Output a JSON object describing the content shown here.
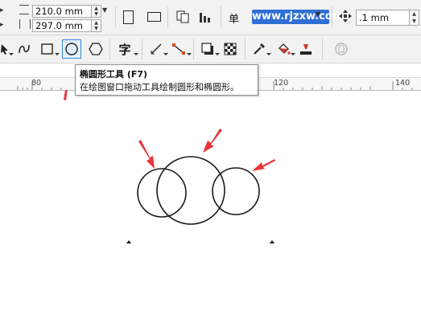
{
  "property_bar": {
    "width_value": "210.0 mm",
    "height_value": "297.0 mm",
    "units_label": "单",
    "nudge_value": ".1 mm"
  },
  "watermark": {
    "text": "www.rjzxw.com"
  },
  "ruler": {
    "labels": [
      "80",
      "120",
      "140"
    ]
  },
  "tooltip": {
    "title": "椭圆形工具 (F7)",
    "description": "在绘图窗口拖动工具绘制圆形和椭圆形。"
  },
  "toolbox": {
    "tools": [
      "pick-icon",
      "freehand-curve-icon",
      "rectangle-icon",
      "ellipse-icon",
      "polygon-icon",
      "text-icon",
      "dimension-icon",
      "connector-icon",
      "drop-shadow-icon",
      "transparency-icon",
      "eyedropper-icon",
      "fill-icon",
      "outline-pen-icon",
      "lock-icon"
    ],
    "active_tool": "ellipse-icon"
  },
  "canvas": {
    "shapes": [
      "circle",
      "circle",
      "circle"
    ],
    "annotation_arrow_color": "#e8353a"
  },
  "colors": {
    "accent": "#3a86d8",
    "watermark_bg": "#2f6fd4",
    "arrow_red": "#e8353a"
  }
}
